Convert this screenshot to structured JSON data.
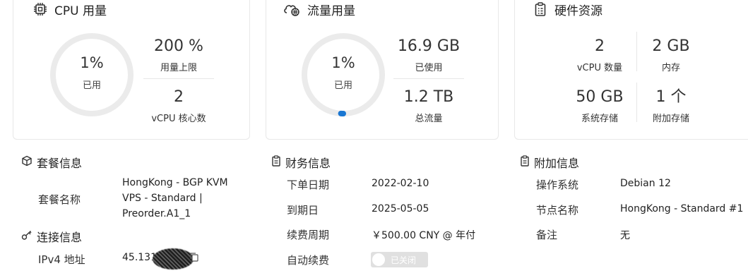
{
  "cpu": {
    "title": "CPU 用量",
    "used_percent": 1,
    "used_text": "1%",
    "used_label": "已用",
    "limit_value": "200 %",
    "limit_label": "用量上限",
    "cores_value": "2",
    "cores_label": "vCPU 核心数"
  },
  "traffic": {
    "title": "流量用量",
    "used_percent": 1,
    "used_text": "1%",
    "used_label": "已用",
    "used_value": "16.9 GB",
    "used_value_label": "已使用",
    "total_value": "1.2 TB",
    "total_label": "总流量",
    "accent": "#1976d2"
  },
  "hardware": {
    "title": "硬件资源",
    "vcpu_value": "2",
    "vcpu_label": "vCPU 数量",
    "mem_value": "2 GB",
    "mem_label": "内存",
    "disk_value": "50 GB",
    "disk_label": "系统存储",
    "extra_value": "1 个",
    "extra_label": "附加存储"
  },
  "plan": {
    "title": "套餐信息",
    "name_label": "套餐名称",
    "name_value_lines": [
      "HongKong - BGP KVM",
      "VPS - Standard |",
      "Preorder.A1_1"
    ]
  },
  "connection": {
    "title": "连接信息",
    "ipv4_label": "IPv4 地址",
    "ipv4_value": "45.131"
  },
  "finance": {
    "title": "财务信息",
    "order_date_label": "下单日期",
    "order_date_value": "2022-02-10",
    "expire_label": "到期日",
    "expire_value": "2025-05-05",
    "renew_cycle_label": "续费周期",
    "renew_cycle_value": "￥500.00 CNY @ 年付",
    "auto_renew_label": "自动续费",
    "auto_renew_state": "已关闭"
  },
  "extra": {
    "title": "附加信息",
    "os_label": "操作系统",
    "os_value": "Debian 12",
    "node_label": "节点名称",
    "node_value": "HongKong - Standard #1",
    "note_label": "备注",
    "note_value": "无"
  },
  "colors": {
    "ring_track": "#ebebeb",
    "progress": "#1976d2",
    "toggle_off": "#e0e0e0"
  },
  "icons": [
    "cpu-icon",
    "cloud-globe-icon",
    "clipboard-icon",
    "package-icon",
    "key-icon",
    "receipt-icon",
    "copy-icon"
  ]
}
